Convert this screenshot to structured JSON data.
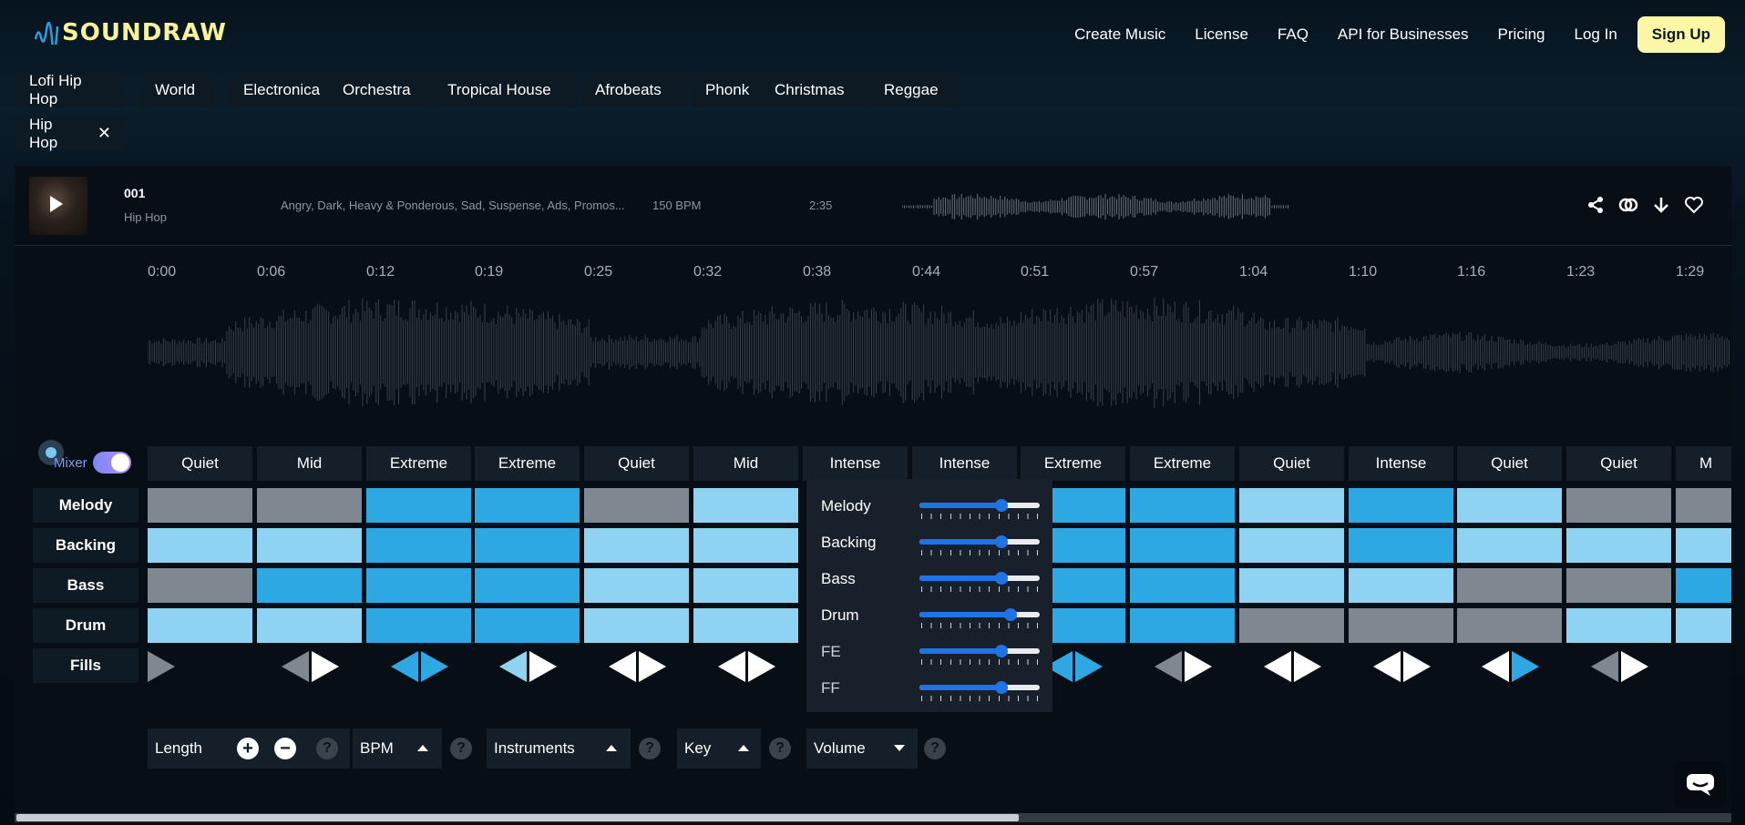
{
  "header": {
    "logo": "SOUNDRAW",
    "nav": [
      "Create Music",
      "License",
      "FAQ",
      "API for Businesses",
      "Pricing",
      "Log In"
    ],
    "signup": "Sign Up"
  },
  "genres": [
    "Lofi Hip Hop",
    "World",
    "Electronica",
    "Orchestra",
    "Tropical House",
    "Afrobeats",
    "Phonk",
    "Christmas",
    "Reggae"
  ],
  "active_genre": "Hip Hop",
  "track": {
    "title": "001",
    "genre": "Hip Hop",
    "tags": "Angry, Dark, Heavy & Ponderous, Sad, Suspense, Ads, Promos...",
    "bpm": "150 BPM",
    "duration": "2:35"
  },
  "timeline": [
    "0:00",
    "0:06",
    "0:12",
    "0:19",
    "0:25",
    "0:32",
    "0:38",
    "0:44",
    "0:51",
    "0:57",
    "1:04",
    "1:10",
    "1:16",
    "1:23",
    "1:29"
  ],
  "mixer_label": "Mixer",
  "energy": [
    "Quiet",
    "Mid",
    "Extreme",
    "Extreme",
    "Quiet",
    "Mid",
    "Intense",
    "Intense",
    "Extreme",
    "Extreme",
    "Quiet",
    "Intense",
    "Quiet",
    "Quiet",
    "M"
  ],
  "rows": [
    "Melody",
    "Backing",
    "Bass",
    "Drum",
    "Fills"
  ],
  "grid_levels": {
    "Melody": [
      0,
      0,
      2,
      2,
      0,
      1,
      -1,
      -1,
      2,
      2,
      1,
      2,
      1,
      0,
      0
    ],
    "Backing": [
      1,
      1,
      2,
      2,
      1,
      1,
      -1,
      -1,
      2,
      2,
      1,
      2,
      1,
      1,
      1
    ],
    "Bass": [
      0,
      2,
      2,
      2,
      1,
      1,
      -1,
      -1,
      2,
      2,
      1,
      1,
      0,
      0,
      2
    ],
    "Drum": [
      1,
      1,
      2,
      2,
      1,
      1,
      -1,
      -1,
      2,
      2,
      0,
      0,
      0,
      1,
      1
    ]
  },
  "volume_popup": {
    "items": [
      {
        "label": "Melody",
        "level": 0.68
      },
      {
        "label": "Backing",
        "level": 0.68
      },
      {
        "label": "Bass",
        "level": 0.68
      },
      {
        "label": "Drum",
        "level": 0.76
      },
      {
        "label": "FE",
        "level": 0.68
      },
      {
        "label": "FF",
        "level": 0.68
      }
    ]
  },
  "controls": {
    "length": "Length",
    "bpm": "BPM",
    "instruments": "Instruments",
    "key": "Key",
    "volume": "Volume",
    "help": "?",
    "plus": "+",
    "minus": "−"
  },
  "colors": {
    "accent": "#2da8e2",
    "light": "#8fd3f3",
    "off": "#7f8890",
    "logo": "#f8f29a",
    "signup_bg": "#fbf7a6"
  }
}
